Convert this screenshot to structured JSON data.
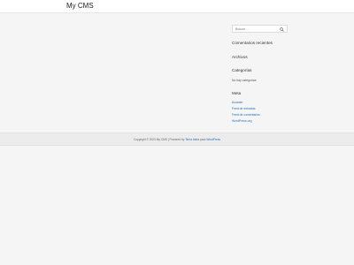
{
  "header": {
    "site_title": "My CMS"
  },
  "sidebar": {
    "search": {
      "placeholder": "Buscar ..."
    },
    "recent_comments_title": "Comentarios recientes",
    "archives_title": "Archivos",
    "categories_title": "Categorías",
    "categories_empty": "No hay categorías",
    "meta_title": "Meta",
    "meta_links": [
      "Acceder",
      "Feed de entradas",
      "Feed de comentarios",
      "WordPress.org"
    ]
  },
  "footer": {
    "copyright": "Copyright © 2023 My CMS | Powered by",
    "theme_link": "Tema Astra",
    "para": "para",
    "wp_link": "WordPress"
  }
}
